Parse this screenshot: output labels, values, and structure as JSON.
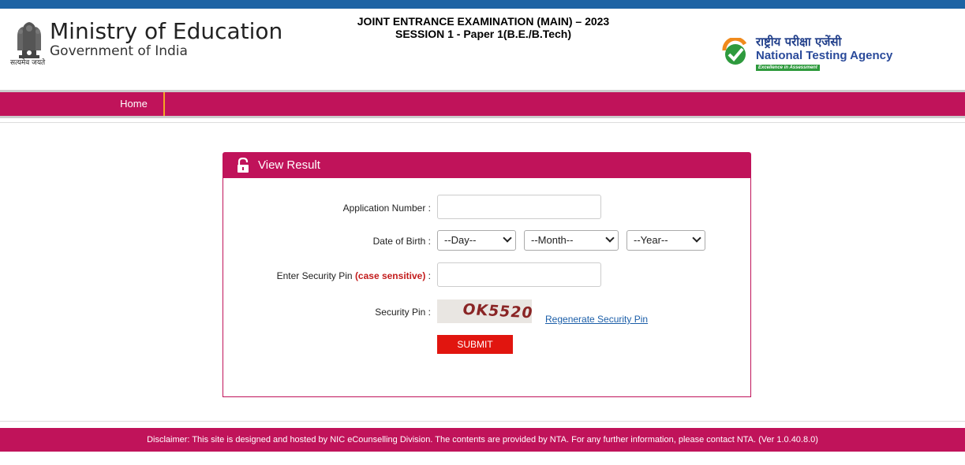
{
  "header": {
    "ministry_title": "Ministry of Education",
    "ministry_sub": "Government of India",
    "emblem_motto": "सत्यमेव जयते",
    "exam_line1": "JOINT ENTRANCE EXAMINATION (MAIN) – 2023",
    "exam_line2": "SESSION 1 - Paper 1(B.E./B.Tech)",
    "nta_hindi": "राष्ट्रीय परीक्षा एजेंसी",
    "nta_english": "National Testing Agency",
    "nta_tagline": "Excellence in Assessment"
  },
  "nav": {
    "home_label": "Home"
  },
  "panel": {
    "title": "View Result",
    "lock_icon": "lock-icon",
    "application_number_label": "Application Number :",
    "application_number_value": "",
    "dob_label": "Date of Birth :",
    "day_selected": "--Day--",
    "month_selected": "--Month--",
    "year_selected": "--Year--",
    "security_pin_label": "Enter Security Pin ",
    "case_sensitive": "(case sensitive)",
    "security_pin_label_suffix": " :",
    "security_pin_value": "",
    "captcha_label": "Security Pin :",
    "captcha_text": "OK5520",
    "regenerate_label": "Regenerate Security Pin",
    "submit_label": "SUBMIT"
  },
  "footer": {
    "disclaimer": "Disclaimer: This site is designed and hosted by NIC eCounselling Division. The contents are provided by NTA. For any further information, please contact NTA. (Ver 1.0.40.8.0)"
  },
  "colors": {
    "topbar": "#1d63a4",
    "brand": "#c0135a",
    "nav_divider": "#f5a623",
    "submit": "#e1150f",
    "link": "#1b5ea8",
    "case_sensitive": "#c31c1c"
  }
}
